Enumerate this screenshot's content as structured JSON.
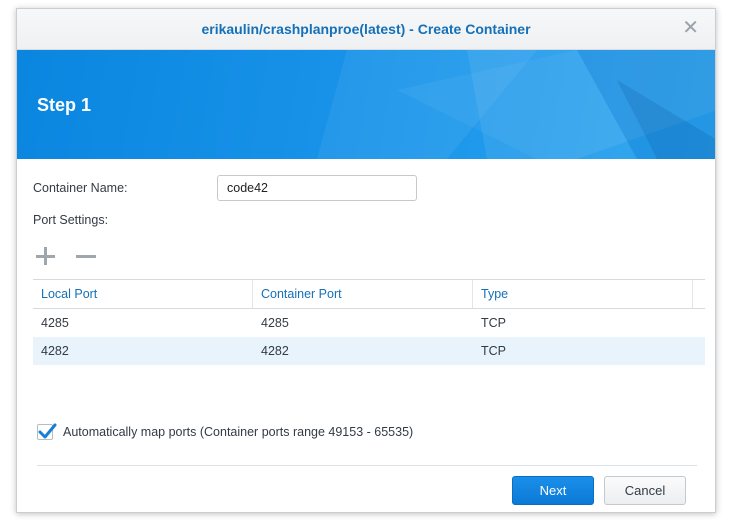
{
  "dialog": {
    "title": "erikaulin/crashplanproe(latest) - Create Container",
    "close_icon": "close-icon"
  },
  "banner": {
    "step": "Step 1"
  },
  "form": {
    "container_name_label": "Container Name:",
    "container_name_value": "code42",
    "port_settings_label": "Port Settings:",
    "add_icon": "plus-icon",
    "remove_icon": "minus-icon"
  },
  "ports_table": {
    "columns": [
      "Local Port",
      "Container Port",
      "Type"
    ],
    "rows": [
      {
        "local": "4285",
        "container": "4285",
        "type": "TCP"
      },
      {
        "local": "4282",
        "container": "4282",
        "type": "TCP"
      }
    ]
  },
  "auto_map": {
    "checked": true,
    "label": "Automatically map ports (Container ports range 49153 - 65535)"
  },
  "buttons": {
    "next": "Next",
    "cancel": "Cancel"
  },
  "colors": {
    "accent": "#1470b8",
    "banner": "#1892e8",
    "selected_row": "#e8f3fb"
  }
}
